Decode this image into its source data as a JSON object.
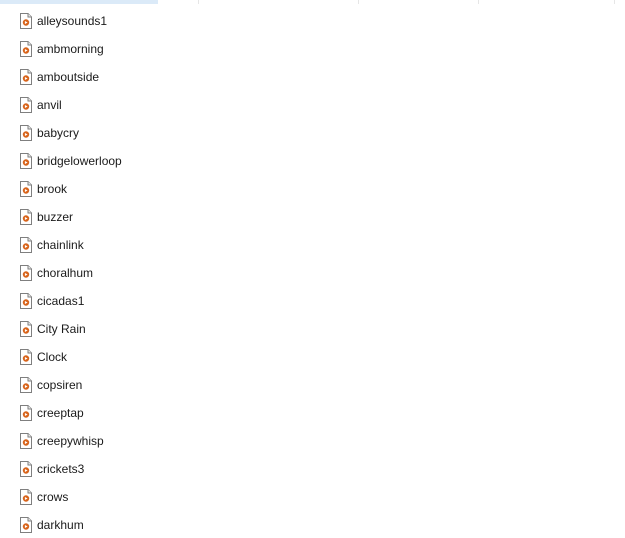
{
  "files": [
    {
      "name": "alleysounds1",
      "icon": "audio-file-icon"
    },
    {
      "name": "ambmorning",
      "icon": "audio-file-icon"
    },
    {
      "name": "amboutside",
      "icon": "audio-file-icon"
    },
    {
      "name": "anvil",
      "icon": "audio-file-icon"
    },
    {
      "name": "babycry",
      "icon": "audio-file-icon"
    },
    {
      "name": "bridgelowerloop",
      "icon": "audio-file-icon"
    },
    {
      "name": "brook",
      "icon": "audio-file-icon"
    },
    {
      "name": "buzzer",
      "icon": "audio-file-icon"
    },
    {
      "name": "chainlink",
      "icon": "audio-file-icon"
    },
    {
      "name": "choralhum",
      "icon": "audio-file-icon"
    },
    {
      "name": "cicadas1",
      "icon": "audio-file-icon"
    },
    {
      "name": "City Rain",
      "icon": "audio-file-icon"
    },
    {
      "name": "Clock",
      "icon": "audio-file-icon"
    },
    {
      "name": "copsiren",
      "icon": "audio-file-icon"
    },
    {
      "name": "creeptap",
      "icon": "audio-file-icon"
    },
    {
      "name": "creepywhisp",
      "icon": "audio-file-icon"
    },
    {
      "name": "crickets3",
      "icon": "audio-file-icon"
    },
    {
      "name": "crows",
      "icon": "audio-file-icon"
    },
    {
      "name": "darkhum",
      "icon": "audio-file-icon"
    }
  ],
  "colors": {
    "header_selected": "#dbeaf8",
    "icon_accent": "#d8641b"
  }
}
